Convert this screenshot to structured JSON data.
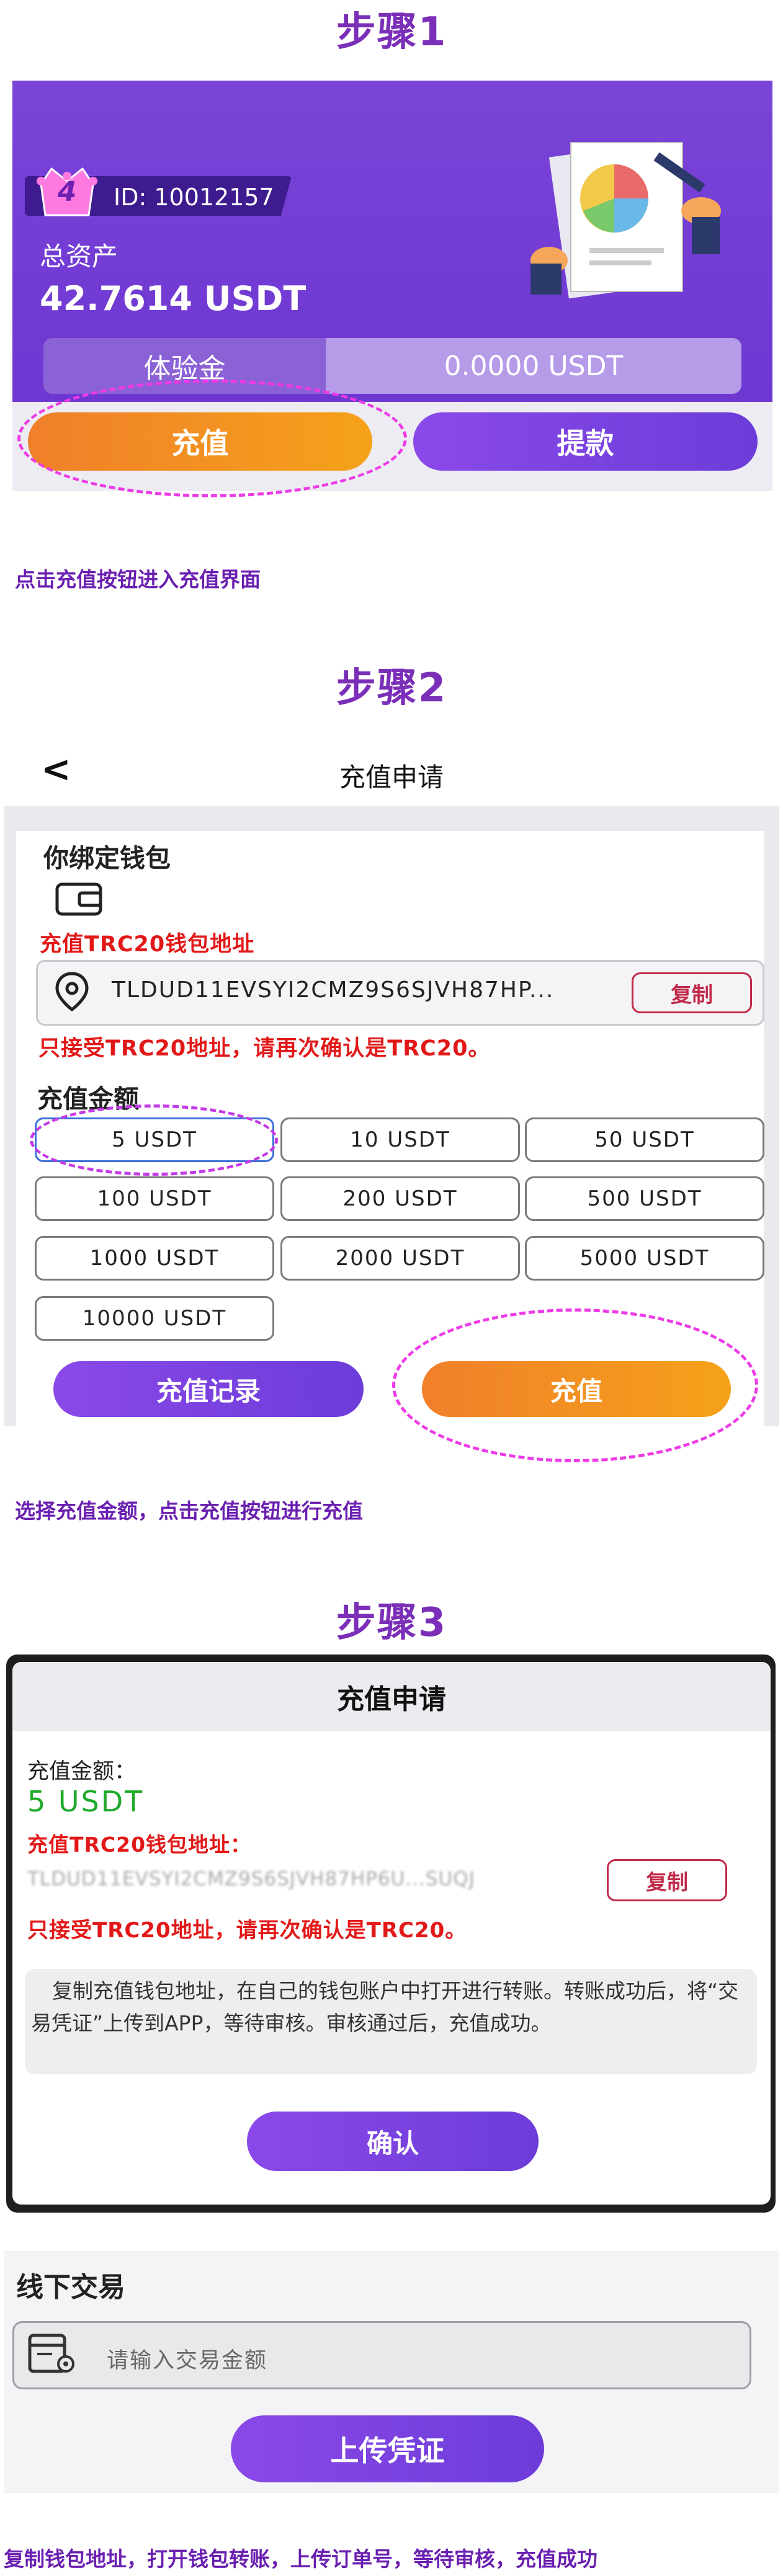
{
  "step1": {
    "title": "步骤1",
    "vip_level": "4",
    "id_text": "ID: 10012157",
    "asset_label": "总资产",
    "asset_value": "42.7614 USDT",
    "trial_label": "体验金",
    "trial_value": "0.0000 USDT",
    "recharge_button": "充值",
    "withdraw_button": "提款",
    "caption": "点击充值按钮进入充值界面"
  },
  "step2": {
    "title": "步骤2",
    "back_icon": "back-arrow-icon",
    "screen_title": "充值申请",
    "wallet_heading": "你绑定钱包",
    "wallet_icon": "wallet-icon",
    "address_label": "充值TRC20钱包地址",
    "address": "TLDUD11EVSYI2CMZ9S6SJVH87HP...",
    "copy_button": "复制",
    "warning": "只接受TRC20地址，请再次确认是TRC20。",
    "amount_heading": "充值金额",
    "amounts": [
      "5 USDT",
      "10 USDT",
      "50 USDT",
      "100 USDT",
      "200 USDT",
      "500 USDT",
      "1000 USDT",
      "2000 USDT",
      "5000 USDT",
      "10000 USDT"
    ],
    "selected_amount": "5 USDT",
    "records_button": "充值记录",
    "recharge_button": "充值",
    "caption": "选择充值金额，点击充值按钮进行充值"
  },
  "step3": {
    "title": "步骤3",
    "dialog_title": "充值申请",
    "amount_label": "充值金额：",
    "amount_value": "5 USDT",
    "address_label": "充值TRC20钱包地址：",
    "address": "TLDUD11EVSYI2CMZ9S6SJVH87HP6U...SUQJ",
    "copy_button": "复制",
    "warning": "只接受TRC20地址，请再次确认是TRC20。",
    "note": "复制充值钱包地址，在自己的钱包账户中打开进行转账。转账成功后，将“交易凭证”上传到APP，等待审核。审核通过后，充值成功。",
    "confirm_button": "确认",
    "offline_title": "线下交易",
    "offline_placeholder": "请输入交易金额",
    "upload_button": "上传凭证",
    "caption": "复制钱包地址，打开钱包转账，上传订单号，等待审核，充值成功"
  },
  "colors": {
    "accent_purple": "#7b2fb8",
    "orange": "#f5a21a",
    "warning_red": "#e21818",
    "amount_green": "#1faa2a",
    "highlight_magenta": "#ee3ae6"
  }
}
